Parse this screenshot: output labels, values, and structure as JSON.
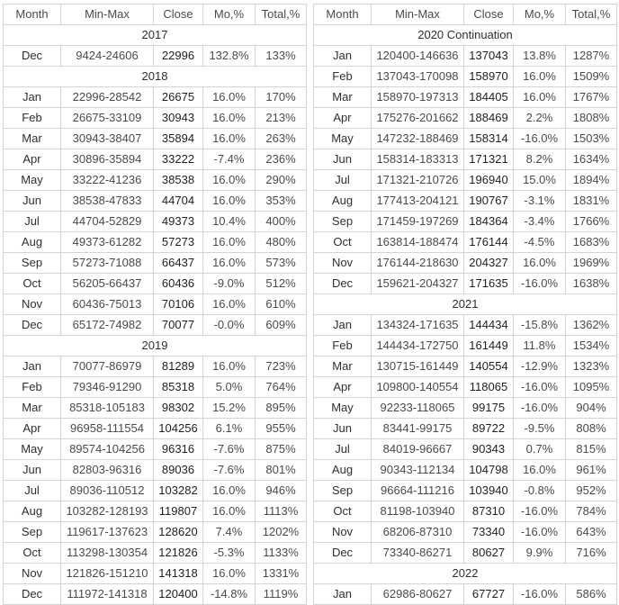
{
  "tables": {
    "left": {
      "headers": [
        "Month",
        "Min-Max",
        "Close",
        "Mo,%",
        "Total,%"
      ],
      "rows": [
        {
          "type": "year",
          "label": "2017"
        },
        {
          "type": "data",
          "month": "Dec",
          "minmax": "9424-24606",
          "close": "22996",
          "mo": "132.8%",
          "total": "133%"
        },
        {
          "type": "year",
          "label": "2018"
        },
        {
          "type": "data",
          "month": "Jan",
          "minmax": "22996-28542",
          "close": "26675",
          "mo": "16.0%",
          "total": "170%"
        },
        {
          "type": "data",
          "month": "Feb",
          "minmax": "26675-33109",
          "close": "30943",
          "mo": "16.0%",
          "total": "213%"
        },
        {
          "type": "data",
          "month": "Mar",
          "minmax": "30943-38407",
          "close": "35894",
          "mo": "16.0%",
          "total": "263%"
        },
        {
          "type": "data",
          "month": "Apr",
          "minmax": "30896-35894",
          "close": "33222",
          "mo": "-7.4%",
          "total": "236%"
        },
        {
          "type": "data",
          "month": "May",
          "minmax": "33222-41236",
          "close": "38538",
          "mo": "16.0%",
          "total": "290%"
        },
        {
          "type": "data",
          "month": "Jun",
          "minmax": "38538-47833",
          "close": "44704",
          "mo": "16.0%",
          "total": "353%"
        },
        {
          "type": "data",
          "month": "Jul",
          "minmax": "44704-52829",
          "close": "49373",
          "mo": "10.4%",
          "total": "400%"
        },
        {
          "type": "data",
          "month": "Aug",
          "minmax": "49373-61282",
          "close": "57273",
          "mo": "16.0%",
          "total": "480%"
        },
        {
          "type": "data",
          "month": "Sep",
          "minmax": "57273-71088",
          "close": "66437",
          "mo": "16.0%",
          "total": "573%"
        },
        {
          "type": "data",
          "month": "Oct",
          "minmax": "56205-66437",
          "close": "60436",
          "mo": "-9.0%",
          "total": "512%"
        },
        {
          "type": "data",
          "month": "Nov",
          "minmax": "60436-75013",
          "close": "70106",
          "mo": "16.0%",
          "total": "610%"
        },
        {
          "type": "data",
          "month": "Dec",
          "minmax": "65172-74982",
          "close": "70077",
          "mo": "-0.0%",
          "total": "609%"
        },
        {
          "type": "year",
          "label": "2019"
        },
        {
          "type": "data",
          "month": "Jan",
          "minmax": "70077-86979",
          "close": "81289",
          "mo": "16.0%",
          "total": "723%"
        },
        {
          "type": "data",
          "month": "Feb",
          "minmax": "79346-91290",
          "close": "85318",
          "mo": "5.0%",
          "total": "764%"
        },
        {
          "type": "data",
          "month": "Mar",
          "minmax": "85318-105183",
          "close": "98302",
          "mo": "15.2%",
          "total": "895%"
        },
        {
          "type": "data",
          "month": "Apr",
          "minmax": "96958-111554",
          "close": "104256",
          "mo": "6.1%",
          "total": "955%"
        },
        {
          "type": "data",
          "month": "May",
          "minmax": "89574-104256",
          "close": "96316",
          "mo": "-7.6%",
          "total": "875%"
        },
        {
          "type": "data",
          "month": "Jun",
          "minmax": "82803-96316",
          "close": "89036",
          "mo": "-7.6%",
          "total": "801%"
        },
        {
          "type": "data",
          "month": "Jul",
          "minmax": "89036-110512",
          "close": "103282",
          "mo": "16.0%",
          "total": "946%"
        },
        {
          "type": "data",
          "month": "Aug",
          "minmax": "103282-128193",
          "close": "119807",
          "mo": "16.0%",
          "total": "1113%"
        },
        {
          "type": "data",
          "month": "Sep",
          "minmax": "119617-137623",
          "close": "128620",
          "mo": "7.4%",
          "total": "1202%"
        },
        {
          "type": "data",
          "month": "Oct",
          "minmax": "113298-130354",
          "close": "121826",
          "mo": "-5.3%",
          "total": "1133%"
        },
        {
          "type": "data",
          "month": "Nov",
          "minmax": "121826-151210",
          "close": "141318",
          "mo": "16.0%",
          "total": "1331%"
        },
        {
          "type": "data",
          "month": "Dec",
          "minmax": "111972-141318",
          "close": "120400",
          "mo": "-14.8%",
          "total": "1119%"
        }
      ]
    },
    "right": {
      "headers": [
        "Month",
        "Min-Max",
        "Close",
        "Mo,%",
        "Total,%"
      ],
      "rows": [
        {
          "type": "year",
          "label": "2020 Continuation"
        },
        {
          "type": "data",
          "month": "Jan",
          "minmax": "120400-146636",
          "close": "137043",
          "mo": "13.8%",
          "total": "1287%"
        },
        {
          "type": "data",
          "month": "Feb",
          "minmax": "137043-170098",
          "close": "158970",
          "mo": "16.0%",
          "total": "1509%"
        },
        {
          "type": "data",
          "month": "Mar",
          "minmax": "158970-197313",
          "close": "184405",
          "mo": "16.0%",
          "total": "1767%"
        },
        {
          "type": "data",
          "month": "Apr",
          "minmax": "175276-201662",
          "close": "188469",
          "mo": "2.2%",
          "total": "1808%"
        },
        {
          "type": "data",
          "month": "May",
          "minmax": "147232-188469",
          "close": "158314",
          "mo": "-16.0%",
          "total": "1503%"
        },
        {
          "type": "data",
          "month": "Jun",
          "minmax": "158314-183313",
          "close": "171321",
          "mo": "8.2%",
          "total": "1634%"
        },
        {
          "type": "data",
          "month": "Jul",
          "minmax": "171321-210726",
          "close": "196940",
          "mo": "15.0%",
          "total": "1894%"
        },
        {
          "type": "data",
          "month": "Aug",
          "minmax": "177413-204121",
          "close": "190767",
          "mo": "-3.1%",
          "total": "1831%"
        },
        {
          "type": "data",
          "month": "Sep",
          "minmax": "171459-197269",
          "close": "184364",
          "mo": "-3.4%",
          "total": "1766%"
        },
        {
          "type": "data",
          "month": "Oct",
          "minmax": "163814-188474",
          "close": "176144",
          "mo": "-4.5%",
          "total": "1683%"
        },
        {
          "type": "data",
          "month": "Nov",
          "minmax": "176144-218630",
          "close": "204327",
          "mo": "16.0%",
          "total": "1969%"
        },
        {
          "type": "data",
          "month": "Dec",
          "minmax": "159621-204327",
          "close": "171635",
          "mo": "-16.0%",
          "total": "1638%"
        },
        {
          "type": "year",
          "label": "2021"
        },
        {
          "type": "data",
          "month": "Jan",
          "minmax": "134324-171635",
          "close": "144434",
          "mo": "-15.8%",
          "total": "1362%"
        },
        {
          "type": "data",
          "month": "Feb",
          "minmax": "144434-172750",
          "close": "161449",
          "mo": "11.8%",
          "total": "1534%"
        },
        {
          "type": "data",
          "month": "Mar",
          "minmax": "130715-161449",
          "close": "140554",
          "mo": "-12.9%",
          "total": "1323%"
        },
        {
          "type": "data",
          "month": "Apr",
          "minmax": "109800-140554",
          "close": "118065",
          "mo": "-16.0%",
          "total": "1095%"
        },
        {
          "type": "data",
          "month": "May",
          "minmax": "92233-118065",
          "close": "99175",
          "mo": "-16.0%",
          "total": "904%"
        },
        {
          "type": "data",
          "month": "Jun",
          "minmax": "83441-99175",
          "close": "89722",
          "mo": "-9.5%",
          "total": "808%"
        },
        {
          "type": "data",
          "month": "Jul",
          "minmax": "84019-96667",
          "close": "90343",
          "mo": "0.7%",
          "total": "815%"
        },
        {
          "type": "data",
          "month": "Aug",
          "minmax": "90343-112134",
          "close": "104798",
          "mo": "16.0%",
          "total": "961%"
        },
        {
          "type": "data",
          "month": "Sep",
          "minmax": "96664-111216",
          "close": "103940",
          "mo": "-0.8%",
          "total": "952%"
        },
        {
          "type": "data",
          "month": "Oct",
          "minmax": "81198-103940",
          "close": "87310",
          "mo": "-16.0%",
          "total": "784%"
        },
        {
          "type": "data",
          "month": "Nov",
          "minmax": "68206-87310",
          "close": "73340",
          "mo": "-16.0%",
          "total": "643%"
        },
        {
          "type": "data",
          "month": "Dec",
          "minmax": "73340-86271",
          "close": "80627",
          "mo": "9.9%",
          "total": "716%"
        },
        {
          "type": "year",
          "label": "2022"
        },
        {
          "type": "data",
          "month": "Jan",
          "minmax": "62986-80627",
          "close": "67727",
          "mo": "-16.0%",
          "total": "586%"
        }
      ]
    }
  }
}
